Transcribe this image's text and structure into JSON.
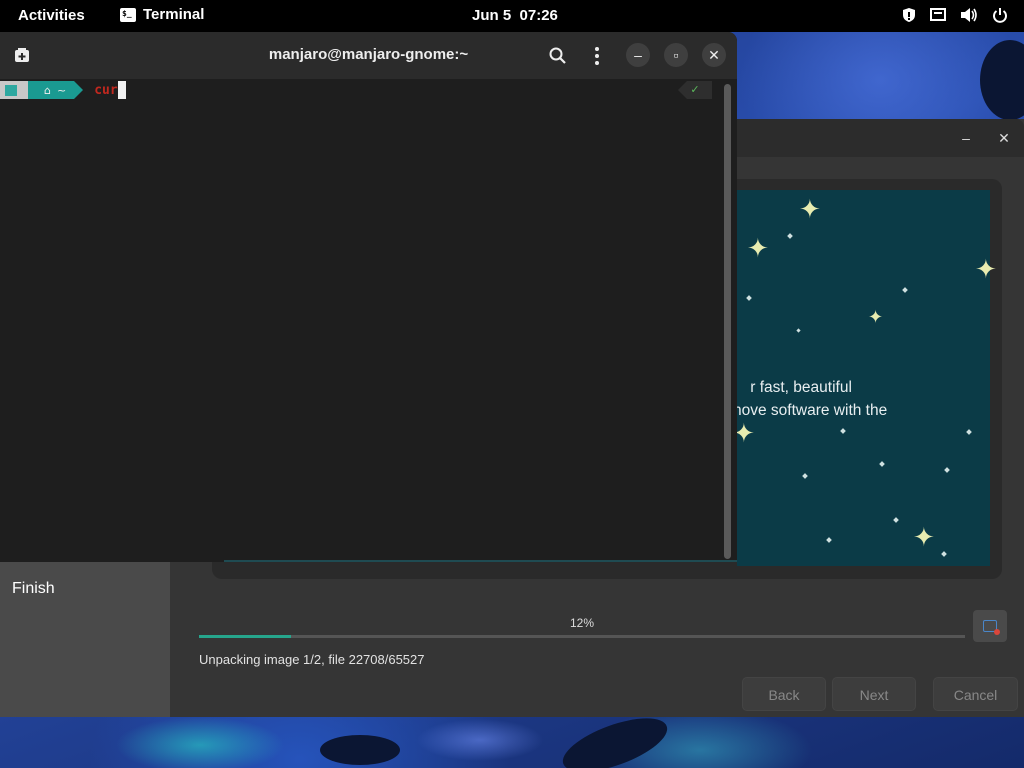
{
  "topbar": {
    "activities": "Activities",
    "app_name": "Terminal",
    "app_icon": "terminal-icon",
    "date": "Jun 5",
    "time": "07:26",
    "tray_icons": [
      "security-icon",
      "network-icon",
      "volume-icon",
      "power-icon"
    ]
  },
  "terminal": {
    "title": "manjaro@manjaro-gnome:~",
    "prompt_dir": "~",
    "command_text": "cur",
    "status_check": "✓"
  },
  "installer": {
    "sidebar_current_step": "Finish",
    "slide_text_line1": "r fast, beautiful",
    "slide_text_line2": "nove software with the",
    "progress_label": "12%",
    "progress_fraction": 0.12,
    "status_text": "Unpacking image 1/2, file 22708/65527",
    "buttons": {
      "back": "Back",
      "next": "Next",
      "cancel": "Cancel"
    },
    "window_controls": {
      "minimize": "–",
      "close": "✕"
    }
  },
  "colors": {
    "accent": "#26a58c",
    "terminal_bg": "#1e1e1e",
    "slide_bg": "#0b3b47",
    "command_red": "#c1281f"
  }
}
